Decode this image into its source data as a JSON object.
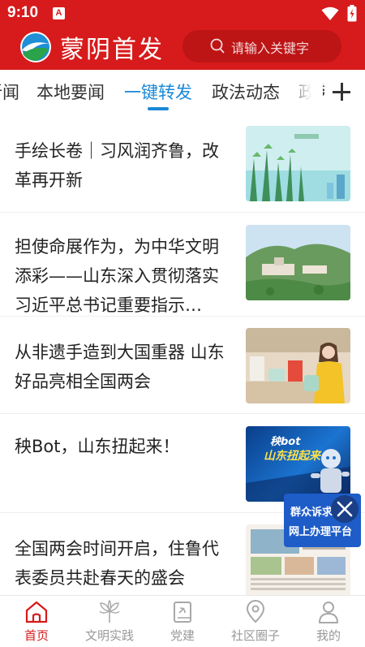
{
  "status_bar": {
    "time": "9:10",
    "notification_glyph": "A"
  },
  "header": {
    "brand": "蒙阴首发",
    "search_placeholder": "请输入关键字"
  },
  "tabs": [
    {
      "label": "新闻",
      "active": false
    },
    {
      "label": "本地要闻",
      "active": false
    },
    {
      "label": "一键转发",
      "active": true
    },
    {
      "label": "政法动态",
      "active": false
    },
    {
      "label": "政务",
      "active": false
    }
  ],
  "news": [
    {
      "title": "手绘长卷｜习风润齐鲁，改革再开新"
    },
    {
      "title": "担使命展作为，为中华文明添彩——山东深入贯彻落实习近平总书记重要指示…"
    },
    {
      "title": "从非遗手造到大国重器  山东好品亮相全国两会"
    },
    {
      "title": "秧Bot，山东扭起来！",
      "thumb_text_1": "秧bot",
      "thumb_text_2": "山东扭起来"
    },
    {
      "title": "全国两会时间开启，住鲁代表委员共赴春天的盛会"
    }
  ],
  "float_badge": {
    "line1": "群众诉求",
    "line2": "网上办理平台"
  },
  "bottom_nav": [
    {
      "label": "首页",
      "icon": "home-icon",
      "active": true
    },
    {
      "label": "文明实践",
      "icon": "peacock-feather-icon",
      "active": false
    },
    {
      "label": "党建",
      "icon": "party-book-icon",
      "active": false
    },
    {
      "label": "社区圈子",
      "icon": "location-pin-icon",
      "active": false
    },
    {
      "label": "我的",
      "icon": "user-icon",
      "active": false
    }
  ],
  "colors": {
    "brand_red": "#d71a1b",
    "tab_active": "#1a88d8",
    "nav_inactive": "#999999"
  }
}
